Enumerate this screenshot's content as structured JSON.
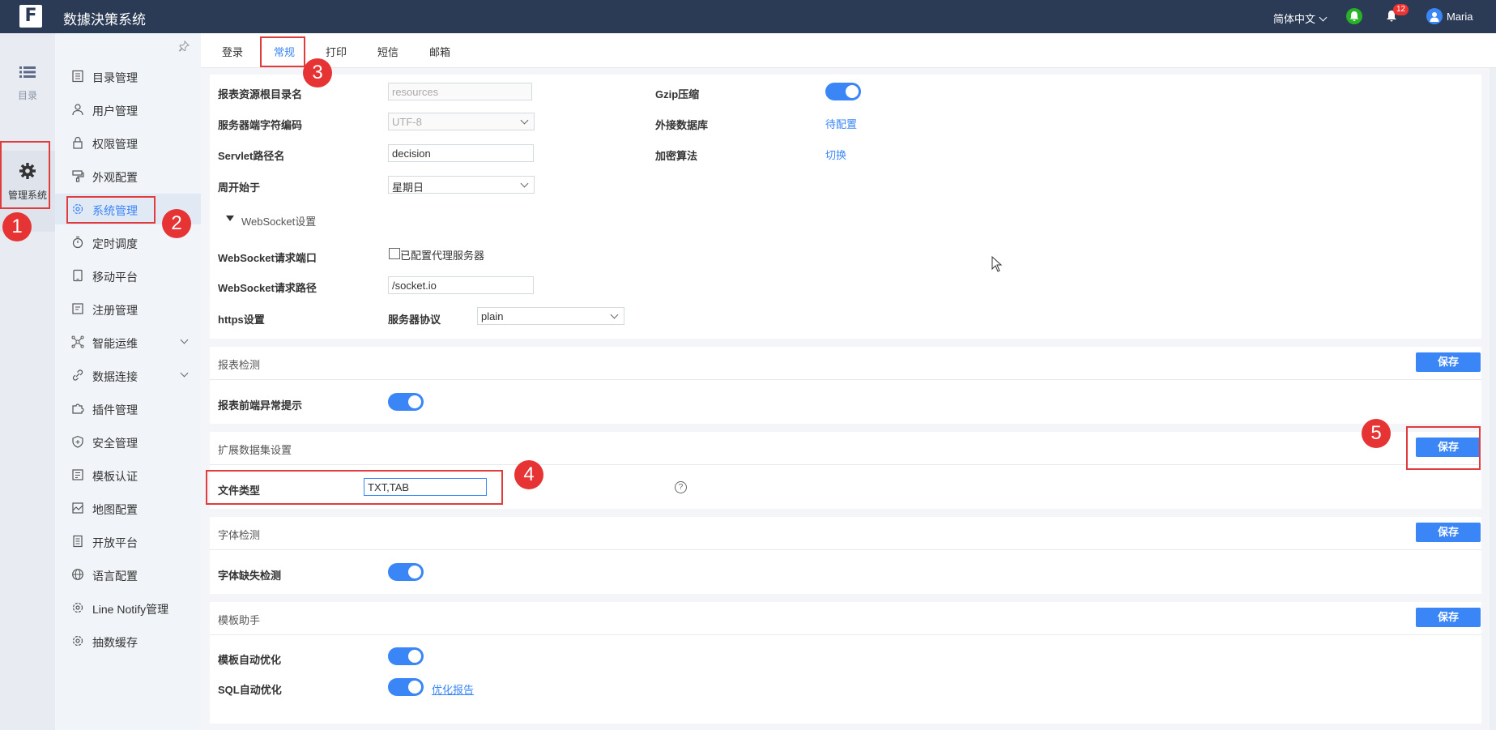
{
  "header": {
    "app_title": "数據決策系统",
    "language": "简体中文",
    "notification_count": "12",
    "username": "Maria"
  },
  "rail": {
    "directory_label": "目录",
    "management_label": "管理系统"
  },
  "sidebar": {
    "items": [
      {
        "label": "目录管理",
        "icon": "list-icon"
      },
      {
        "label": "用户管理",
        "icon": "user-icon"
      },
      {
        "label": "权限管理",
        "icon": "lock-icon"
      },
      {
        "label": "外观配置",
        "icon": "brush-icon"
      },
      {
        "label": "系统管理",
        "icon": "gear-icon"
      },
      {
        "label": "定时调度",
        "icon": "timer-icon"
      },
      {
        "label": "移动平台",
        "icon": "tablet-icon"
      },
      {
        "label": "注册管理",
        "icon": "register-icon"
      },
      {
        "label": "智能运维",
        "icon": "network-icon"
      },
      {
        "label": "数据连接",
        "icon": "link-icon"
      },
      {
        "label": "插件管理",
        "icon": "puzzle-icon"
      },
      {
        "label": "安全管理",
        "icon": "shield-icon"
      },
      {
        "label": "模板认证",
        "icon": "template-icon"
      },
      {
        "label": "地图配置",
        "icon": "map-icon"
      },
      {
        "label": "开放平台",
        "icon": "doc-icon"
      },
      {
        "label": "语言配置",
        "icon": "globe-icon"
      },
      {
        "label": "Line Notify管理",
        "icon": "gear-icon"
      },
      {
        "label": "抽数缓存",
        "icon": "gear-icon"
      }
    ]
  },
  "tabs": [
    "登录",
    "常规",
    "打印",
    "短信",
    "邮箱"
  ],
  "general": {
    "root_dir_label": "报表资源根目录名",
    "root_dir_value": "resources",
    "encoding_label": "服务器端字符编码",
    "encoding_value": "UTF-8",
    "servlet_label": "Servlet路径名",
    "servlet_value": "decision",
    "week_label": "周开始于",
    "week_value": "星期日",
    "gzip_label": "Gzip压缩",
    "ext_db_label": "外接数据库",
    "ext_db_link": "待配置",
    "encrypt_label": "加密算法",
    "encrypt_link": "切换",
    "websocket_section": "WebSocket设置",
    "ws_port_label": "WebSocket请求端口",
    "ws_proxy_label": "已配置代理服务器",
    "ws_path_label": "WebSocket请求路径",
    "ws_path_value": "/socket.io",
    "https_label": "https设置",
    "protocol_label": "服务器协议",
    "protocol_value": "plain"
  },
  "report_check": {
    "title": "报表检测",
    "save": "保存",
    "front_error_label": "报表前端异常提示"
  },
  "ext_dataset": {
    "title": "扩展数据集设置",
    "save": "保存",
    "file_type_label": "文件类型",
    "file_type_value": "TXT,TAB"
  },
  "font_check": {
    "title": "字体检测",
    "save": "保存",
    "missing_label": "字体缺失检测"
  },
  "template_helper": {
    "title": "模板助手",
    "save": "保存",
    "auto_opt_label": "模板自动优化",
    "sql_opt_label": "SQL自动优化",
    "report_link": "优化报告"
  },
  "annotations": [
    "1",
    "2",
    "3",
    "4",
    "5"
  ],
  "colors": {
    "accent": "#3a86f7",
    "topbar": "#2b3a55",
    "annotation": "#e63333"
  }
}
